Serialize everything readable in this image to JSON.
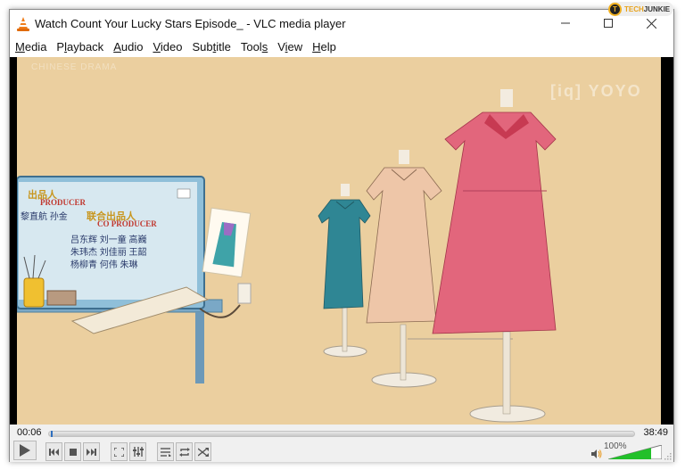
{
  "window": {
    "title": "Watch Count Your Lucky Stars Episode_ - VLC media player",
    "controls": {
      "minimize": "—",
      "maximize": "☐",
      "close": "✕"
    }
  },
  "overlay": {
    "site_brand_part1": "TECH",
    "site_brand_part2": "JUNKIE",
    "site_logo_letter": "T"
  },
  "menu": [
    {
      "label": "Media",
      "accel": "M"
    },
    {
      "label": "Playback",
      "accel": "l"
    },
    {
      "label": "Audio",
      "accel": "A"
    },
    {
      "label": "Video",
      "accel": "V"
    },
    {
      "label": "Subtitle",
      "accel": "t"
    },
    {
      "label": "Tools",
      "accel": "s"
    },
    {
      "label": "View",
      "accel": "i"
    },
    {
      "label": "Help",
      "accel": "H"
    }
  ],
  "video": {
    "watermark_top_left": "CHINESE DRAMA",
    "watermark_top_right": "[iq] YOYO",
    "credits": {
      "producer_cn": "出品人",
      "producer_en": "PRODUCER",
      "producer_names": "黎直航  孙金",
      "coproducer_cn": "联合出品人",
      "coproducer_en": "CO PRODUCER",
      "row1": "吕东辉   刘一童   高巍",
      "row2": "朱玮杰   刘佳丽   王韶",
      "row3": "杨柳青    何伟    朱琳"
    }
  },
  "playback": {
    "elapsed": "00:06",
    "total": "38:49",
    "progress_fraction": 0.0026
  },
  "volume": {
    "label": "100%",
    "level_fraction": 0.8
  },
  "colors": {
    "video_bg": "#ebcf9f",
    "volume_green": "#22c02a",
    "seek_accent": "#2e6fbf"
  }
}
